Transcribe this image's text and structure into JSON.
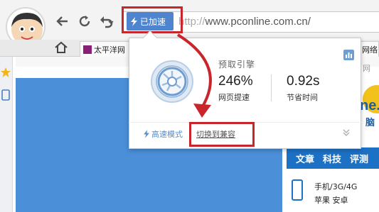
{
  "toolbar": {
    "accelerate_label": "已加速",
    "url_protocol": "http://",
    "url_host": "www.pconline.com.cn/"
  },
  "tabs": [
    {
      "label": "太平洋网"
    },
    {
      "label": "网络"
    }
  ],
  "popup": {
    "title": "预取引擎",
    "speedup_value": "246%",
    "speedup_label": "网页提速",
    "time_value": "0.92s",
    "time_label": "节省时间",
    "mode_label": "高速模式",
    "switch_label": "切换到兼容"
  },
  "page": {
    "side_text": "网",
    "logo_text": "ne.",
    "logo_sub": "脑",
    "nav": [
      "文章",
      "科技",
      "评测"
    ],
    "category_1": "手机/3G/4G",
    "category_2": "苹果 安卓"
  },
  "colors": {
    "accent_blue": "#4f85cf",
    "highlight_red": "#c8262b",
    "page_blue": "#4b8fd9"
  },
  "icons": {
    "back": "back-arrow-icon",
    "refresh": "refresh-icon",
    "undo": "undo-icon",
    "lightning": "lightning-icon",
    "home": "home-icon",
    "chart": "chart-icon",
    "chevrons": "double-chevron-down-icon"
  }
}
